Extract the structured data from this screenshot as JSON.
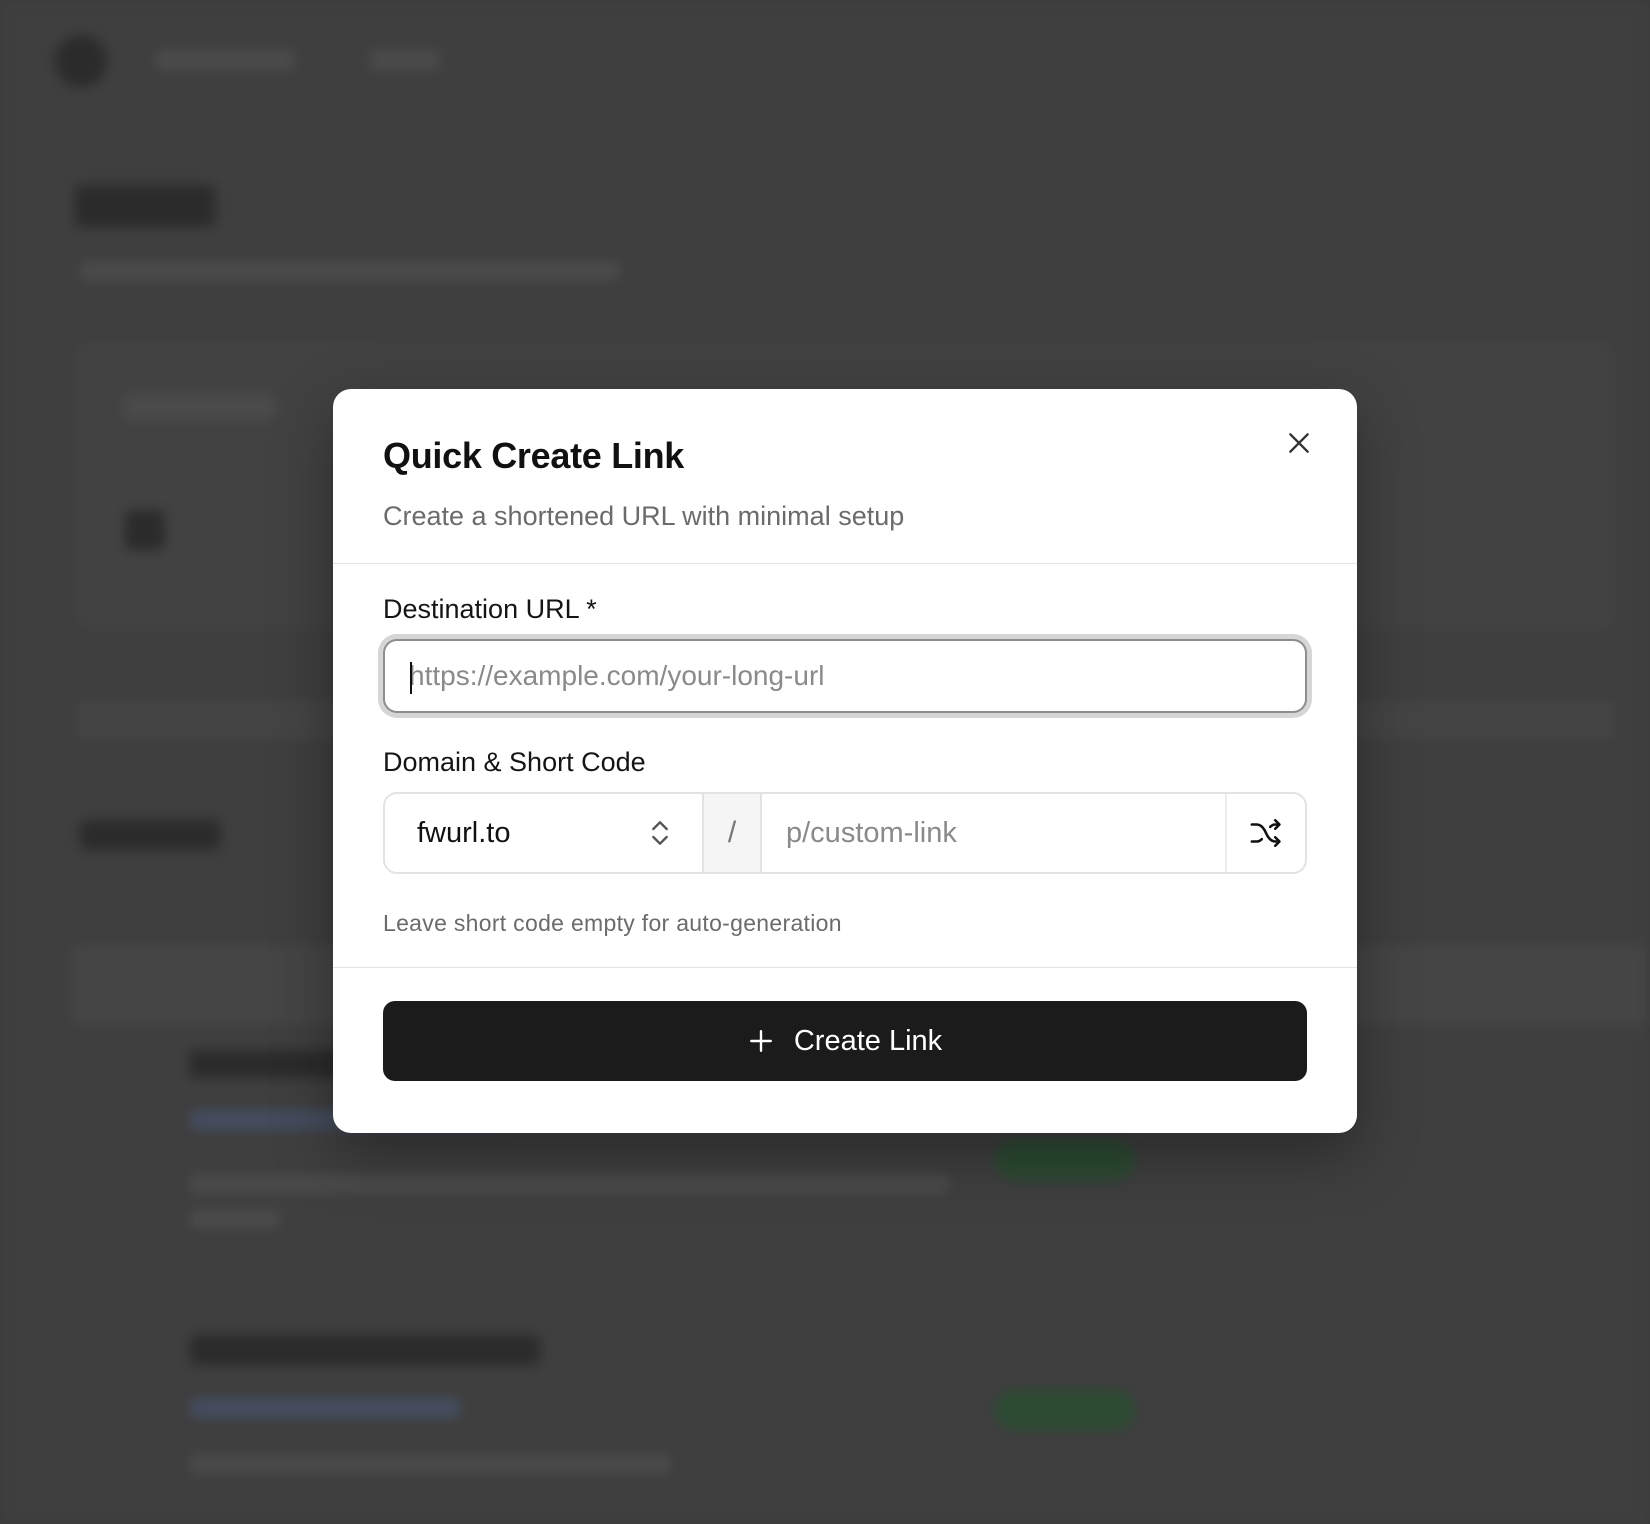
{
  "modal": {
    "title": "Quick Create Link",
    "subtitle": "Create a shortened URL with minimal setup",
    "destination": {
      "label": "Destination URL *",
      "value": "",
      "placeholder": "https://example.com/your-long-url"
    },
    "domain_short_code": {
      "label": "Domain & Short Code",
      "domain_selected": "fwurl.to",
      "separator": "/",
      "short_code_value": "",
      "short_code_placeholder": "p/custom-link"
    },
    "hint": "Leave short code empty for auto-generation",
    "create_button_label": "Create Link",
    "icons": {
      "close": "close-icon",
      "domain_select": "chevron-up-down-icon",
      "randomize": "shuffle-icon",
      "create": "plus-icon"
    }
  },
  "colors": {
    "primary_button": "#1b1b1b",
    "backdrop": "#444444"
  }
}
